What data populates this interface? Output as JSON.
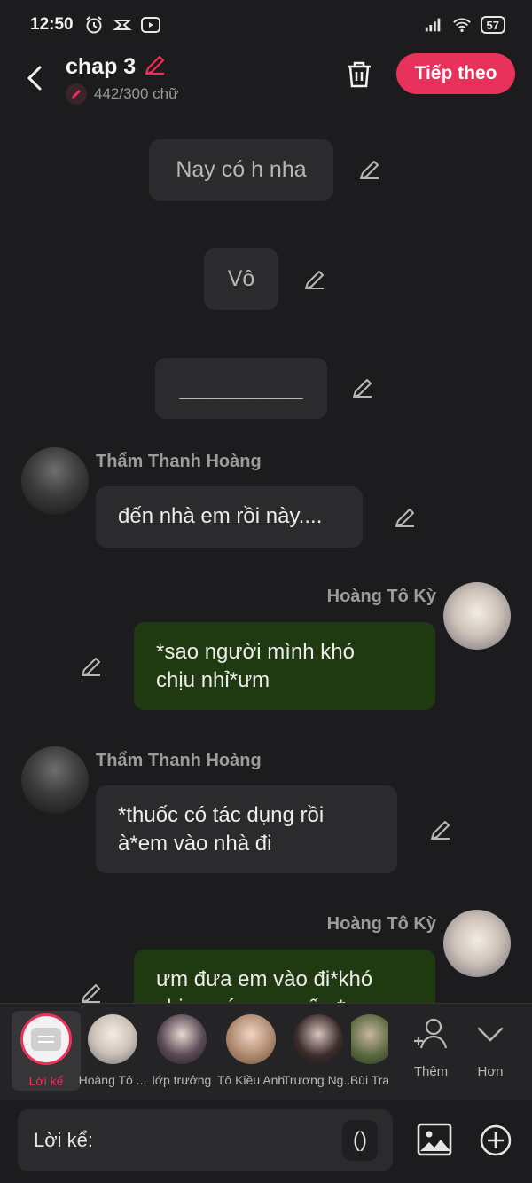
{
  "status_bar": {
    "time": "12:50",
    "battery": "57",
    "icons_left": [
      "alarm-icon",
      "capcut-icon",
      "youtube-icon"
    ],
    "icons_right": [
      "signal-icon",
      "wifi-icon",
      "battery-icon"
    ]
  },
  "header": {
    "title": "chap 3",
    "word_count": "442/300 chữ",
    "next_label": "Tiếp theo",
    "accent_color": "#e8315b"
  },
  "messages": [
    {
      "type": "narration",
      "text": "Nay có h nha"
    },
    {
      "type": "narration",
      "text": "Vô"
    },
    {
      "type": "narration",
      "text": "__________"
    },
    {
      "type": "left",
      "name": "Thẩm Thanh Hoàng",
      "text": "đến nhà em rồi này...."
    },
    {
      "type": "right",
      "name": "Hoàng Tô Kỳ",
      "line1": "*sao người mình khó",
      "line2": "chịu nhỉ*ưm"
    },
    {
      "type": "left",
      "name": "Thẩm Thanh Hoàng",
      "line1": "*thuốc có tác dụng rồi",
      "line2": "à*em vào nhà đi"
    },
    {
      "type": "right",
      "name": "Hoàng Tô Kỳ",
      "line1": "ưm đưa em vào đi*khó",
      "line2": "chịu quá em muốn *"
    }
  ],
  "characters": [
    {
      "label": "Lời kể"
    },
    {
      "label": "Hoàng Tô ..."
    },
    {
      "label": "lớp trưởng"
    },
    {
      "label": "Tô Kiều Anh"
    },
    {
      "label": "Trương Ng..."
    },
    {
      "label": "Bùi Tra"
    }
  ],
  "controls": {
    "add_label": "Thêm",
    "more_label": "Hơn"
  },
  "input": {
    "label": "Lời kể:",
    "paren": "()"
  }
}
